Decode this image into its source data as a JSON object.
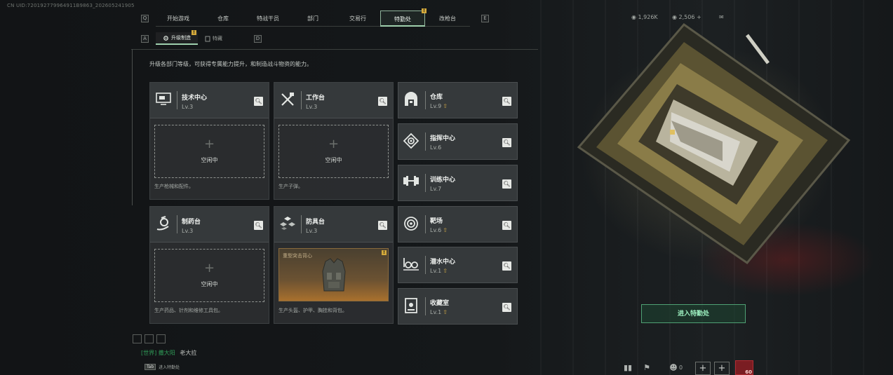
{
  "uid_text": "CN UID:720192779964911B9863_202605241905",
  "nav": {
    "left_key": "Q",
    "right_key": "E",
    "tabs": [
      {
        "label": "开始游戏"
      },
      {
        "label": "仓库"
      },
      {
        "label": "特战干员"
      },
      {
        "label": "部门"
      },
      {
        "label": "交易行"
      },
      {
        "label": "特勤处",
        "active": true,
        "badge": "!"
      },
      {
        "label": "改枪台"
      }
    ]
  },
  "subnav": {
    "left_key": "A",
    "right_key": "D",
    "tabs": [
      {
        "label": "升级制造",
        "active": true,
        "badge": "!"
      },
      {
        "label": "特藏"
      }
    ]
  },
  "description": "升级各部门等级，可获得专属能力提升，和制造战斗物资的能力。",
  "facilities": [
    {
      "title": "技术中心",
      "level": "Lv.3",
      "icon": "monitor-icon",
      "status": "空闲中",
      "footer": "生产枪械和配件。"
    },
    {
      "title": "工作台",
      "level": "Lv.3",
      "icon": "tools-icon",
      "status": "空闲中",
      "footer": "生产子弹。"
    },
    {
      "title": "制药台",
      "level": "Lv.3",
      "icon": "microscope-icon",
      "status": "空闲中",
      "footer": "生产药品、针剂和维修工具包。"
    },
    {
      "title": "防具台",
      "level": "Lv.3",
      "icon": "armor-blocks-icon",
      "featured_item": "重型突击背心",
      "featured_badge": "!",
      "footer": "生产头盔、护甲、胸挂和背包。"
    }
  ],
  "side_facilities": [
    {
      "title": "仓库",
      "level": "Lv.9",
      "icon": "vault-icon",
      "upgrade": true
    },
    {
      "title": "指挥中心",
      "level": "Lv.6",
      "icon": "command-icon",
      "upgrade": false
    },
    {
      "title": "训练中心",
      "level": "Lv.7",
      "icon": "dumbbell-icon",
      "upgrade": false
    },
    {
      "title": "靶场",
      "level": "Lv.6",
      "icon": "target-icon",
      "upgrade": true
    },
    {
      "title": "潜水中心",
      "level": "Lv.1",
      "icon": "diving-icon",
      "upgrade": true
    },
    {
      "title": "收藏室",
      "level": "Lv.1",
      "icon": "collection-icon",
      "upgrade": true
    }
  ],
  "currency": {
    "a": "1,926K",
    "b": "2,506"
  },
  "enter_button": "进入特勤处",
  "chat": {
    "channel": "[世界]",
    "name": "撒大阳",
    "message": "老大拉"
  },
  "tab_hint": {
    "key": "Tab",
    "label": "进入特勤处"
  },
  "bottom": {
    "player_count": "0",
    "avatar_level": "60"
  },
  "colors": {
    "accent_green": "#9fd0ad",
    "badge_yellow": "#d2a83b",
    "enter_border": "#4fa174"
  }
}
